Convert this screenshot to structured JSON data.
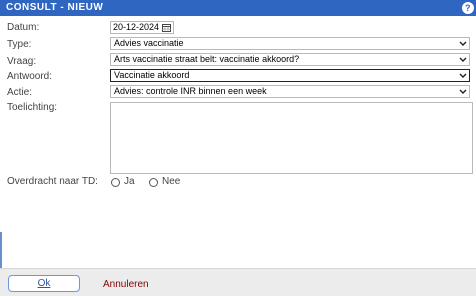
{
  "window": {
    "title": "CONSULT - NIEUW",
    "help_symbol": "?"
  },
  "form": {
    "datum": {
      "label": "Datum:",
      "value": "20-12-2024"
    },
    "type": {
      "label": "Type:",
      "value": "Advies vaccinatie"
    },
    "vraag": {
      "label": "Vraag:",
      "value": "Arts vaccinatie straat belt: vaccinatie akkoord?"
    },
    "antwoord": {
      "label": "Antwoord:",
      "value": "Vaccinatie akkoord"
    },
    "actie": {
      "label": "Actie:",
      "value": "Advies: controle INR binnen een week"
    },
    "toelichting": {
      "label": "Toelichting:",
      "value": ""
    },
    "overdracht": {
      "label": "Overdracht naar TD:",
      "options": [
        "Ja",
        "Nee"
      ]
    }
  },
  "footer": {
    "ok_label": "Ok",
    "cancel_label": "Annuleren",
    "cancel_color": "#8b0000",
    "ok_color": "#2e55a0"
  },
  "colors": {
    "titlebar": "#2f66c1"
  },
  "icons": {
    "help": "help-icon",
    "calendar": "calendar-icon",
    "dropdown": "chevron-down-icon"
  }
}
